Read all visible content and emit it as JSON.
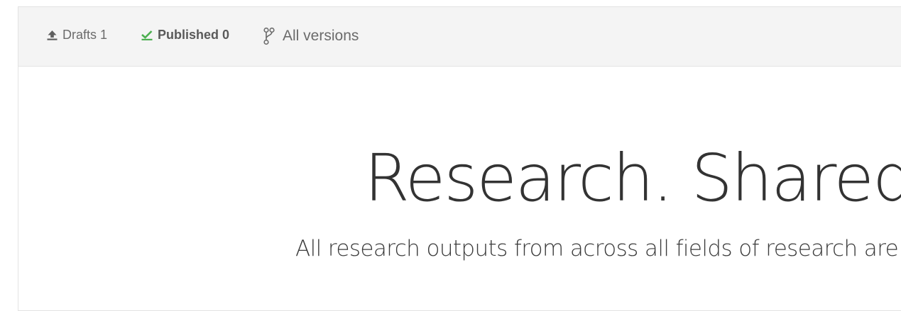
{
  "filters": {
    "drafts": {
      "label": "Drafts",
      "count": "1",
      "icon": "upload-icon"
    },
    "published": {
      "label": "Published",
      "count": "0",
      "icon": "check-icon",
      "icon_color": "#4caf50"
    },
    "all_versions": {
      "label": "All versions",
      "icon": "branch-icon"
    }
  },
  "hero": {
    "title": "Research. Shared.",
    "subtitle": "All research outputs from across all fields of research are we"
  }
}
